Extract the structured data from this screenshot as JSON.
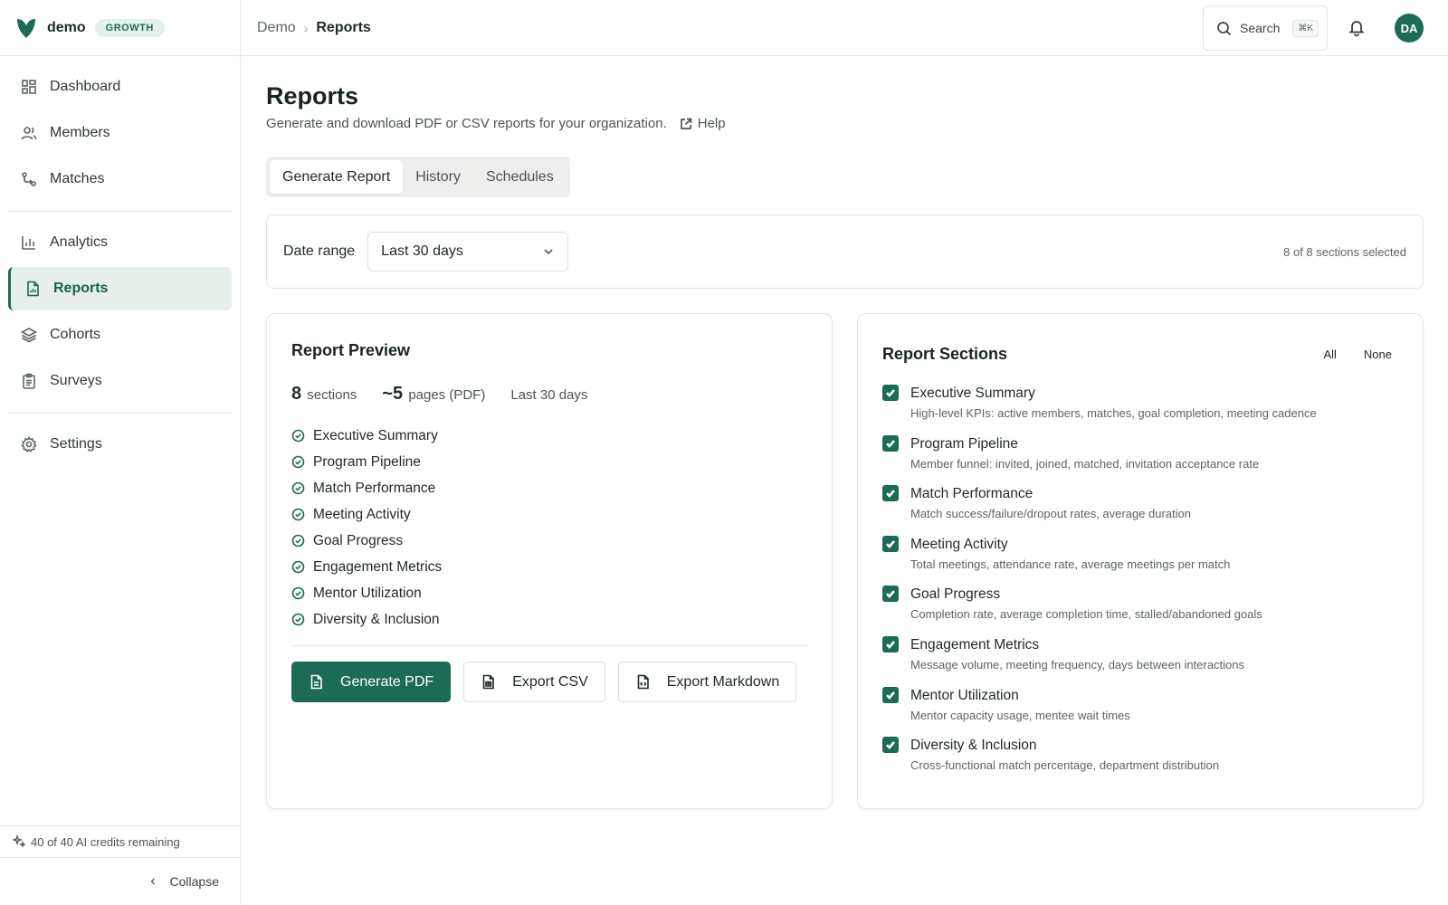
{
  "brand": {
    "name": "demo",
    "plan": "GROWTH"
  },
  "sidebar": {
    "groups": [
      [
        {
          "label": "Dashboard",
          "icon": "grid-icon"
        },
        {
          "label": "Members",
          "icon": "users-icon"
        },
        {
          "label": "Matches",
          "icon": "match-icon"
        }
      ],
      [
        {
          "label": "Analytics",
          "icon": "bar-chart-icon"
        },
        {
          "label": "Reports",
          "icon": "file-icon"
        },
        {
          "label": "Cohorts",
          "icon": "layers-icon"
        },
        {
          "label": "Surveys",
          "icon": "clipboard-icon"
        }
      ],
      [
        {
          "label": "Settings",
          "icon": "gear-icon"
        }
      ]
    ],
    "active": "Reports",
    "credits": "40 of 40 AI credits remaining",
    "collapse": "Collapse"
  },
  "topbar": {
    "breadcrumb": [
      "Demo",
      "Reports"
    ],
    "search_label": "Search",
    "search_kbd": "⌘K",
    "avatar": "DA"
  },
  "page": {
    "title": "Reports",
    "subtitle": "Generate and download PDF or CSV reports for your organization.",
    "help": "Help",
    "tabs": [
      "Generate Report",
      "History",
      "Schedules"
    ],
    "active_tab": "Generate Report"
  },
  "filters": {
    "date_label": "Date range",
    "date_value": "Last 30 days",
    "selected_count": "8 of 8 sections selected"
  },
  "preview": {
    "title": "Report Preview",
    "sections_count": "8",
    "sections_label": "sections",
    "pages_count": "~5",
    "pages_label": "pages (PDF)",
    "range": "Last 30 days",
    "items": [
      "Executive Summary",
      "Program Pipeline",
      "Match Performance",
      "Meeting Activity",
      "Goal Progress",
      "Engagement Metrics",
      "Mentor Utilization",
      "Diversity & Inclusion"
    ],
    "buttons": {
      "pdf": "Generate PDF",
      "csv": "Export CSV",
      "markdown": "Export Markdown"
    }
  },
  "sections": {
    "title": "Report Sections",
    "all": "All",
    "none": "None",
    "items": [
      {
        "title": "Executive Summary",
        "desc": "High-level KPIs: active members, matches, goal completion, meeting cadence",
        "checked": true
      },
      {
        "title": "Program Pipeline",
        "desc": "Member funnel: invited, joined, matched, invitation acceptance rate",
        "checked": true
      },
      {
        "title": "Match Performance",
        "desc": "Match success/failure/dropout rates, average duration",
        "checked": true
      },
      {
        "title": "Meeting Activity",
        "desc": "Total meetings, attendance rate, average meetings per match",
        "checked": true
      },
      {
        "title": "Goal Progress",
        "desc": "Completion rate, average completion time, stalled/abandoned goals",
        "checked": true
      },
      {
        "title": "Engagement Metrics",
        "desc": "Message volume, meeting frequency, days between interactions",
        "checked": true
      },
      {
        "title": "Mentor Utilization",
        "desc": "Mentor capacity usage, mentee wait times",
        "checked": true
      },
      {
        "title": "Diversity & Inclusion",
        "desc": "Cross-functional match percentage, department distribution",
        "checked": true
      }
    ]
  },
  "colors": {
    "accent": "#1b6b57",
    "accent_light": "#e4f0ea"
  }
}
